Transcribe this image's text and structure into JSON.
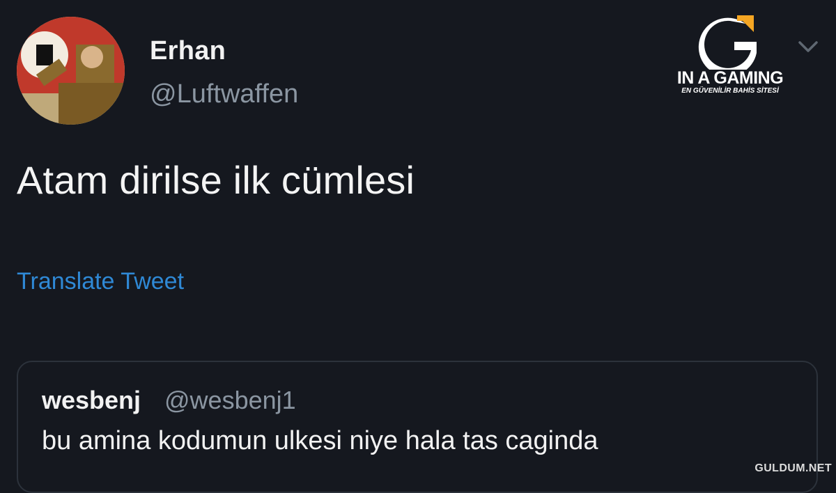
{
  "tweet": {
    "display_name": "Erhan",
    "handle": "@Luftwaffen",
    "text": "Atam dirilse ilk cümlesi",
    "translate_label": "Translate Tweet",
    "menu_icon": "chevron-down-icon"
  },
  "quoted_tweet": {
    "display_name": "wesbenj",
    "handle": "@wesbenj1",
    "text": "bu amina kodumun ulkesi niye hala tas caginda"
  },
  "brand_overlay": {
    "title": "IN A GAMING",
    "tagline": "EN GÜVENİLİR BAHİS SİTESİ",
    "accent_color": "#f5a623"
  },
  "watermark": {
    "text": "GULDUM.NET"
  },
  "colors": {
    "background": "#15181f",
    "link": "#2f89d6",
    "secondary_text": "#8b96a2",
    "border": "#2c323b"
  }
}
